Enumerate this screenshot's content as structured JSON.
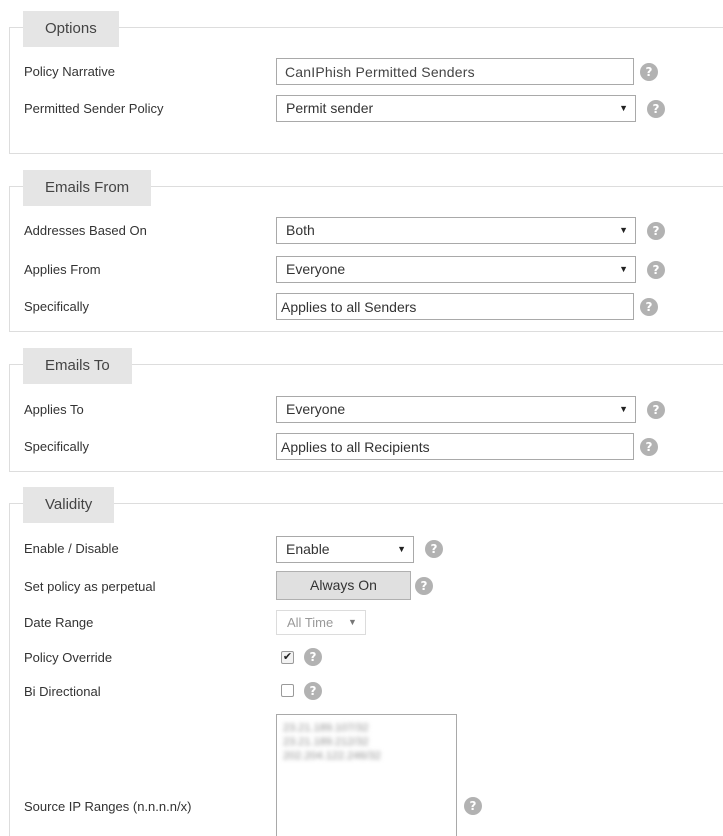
{
  "help_glyph": "?",
  "options": {
    "legend": "Options",
    "policy_narrative_label": "Policy Narrative",
    "policy_narrative_value": "CanIPhish Permitted Senders",
    "permitted_sender_policy_label": "Permitted Sender Policy",
    "permitted_sender_policy_value": "Permit sender"
  },
  "emails_from": {
    "legend": "Emails From",
    "addresses_based_on_label": "Addresses Based On",
    "addresses_based_on_value": "Both",
    "applies_from_label": "Applies From",
    "applies_from_value": "Everyone",
    "specifically_label": "Specifically",
    "specifically_value": "Applies to all Senders"
  },
  "emails_to": {
    "legend": "Emails To",
    "applies_to_label": "Applies To",
    "applies_to_value": "Everyone",
    "specifically_label": "Specifically",
    "specifically_value": "Applies to all Recipients"
  },
  "validity": {
    "legend": "Validity",
    "enable_disable_label": "Enable / Disable",
    "enable_disable_value": "Enable",
    "perpetual_label": "Set policy as perpetual",
    "perpetual_button": "Always On",
    "date_range_label": "Date Range",
    "date_range_value": "All Time",
    "policy_override_label": "Policy Override",
    "policy_override_checked": true,
    "bi_directional_label": "Bi Directional",
    "bi_directional_checked": false,
    "source_ip_label": "Source IP Ranges (n.n.n.n/x)",
    "source_ip_ranges": [
      "23.21.189.107/32",
      "23.21.189.212/32",
      "202.204.122.246/32"
    ]
  },
  "colors": {
    "legend_bg": "#e5e5e5",
    "border": "#dddddd",
    "help_icon": "#b2b2b2"
  }
}
